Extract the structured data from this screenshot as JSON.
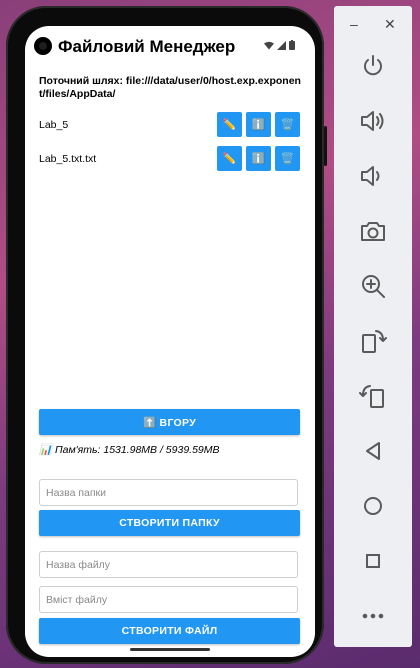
{
  "app": {
    "title": "Файловий Менеджер"
  },
  "path": {
    "text": "Поточний шлях: file:///data/user/0/host.exp.exponent/files/AppData/"
  },
  "files": [
    {
      "name": "Lab_5"
    },
    {
      "name": "Lab_5.txt.txt"
    }
  ],
  "actions": {
    "rename_icon": "✏️",
    "info_icon": "ℹ️",
    "delete_icon": "🗑️"
  },
  "buttons": {
    "up": "⬆️ ВГОРУ",
    "create_folder": "СТВОРИТИ ПАПКУ",
    "create_file": "СТВОРИТИ ФАЙЛ"
  },
  "memory": {
    "text": "📊 Пам'ять: 1531.98MB / 5939.59MB"
  },
  "inputs": {
    "folder_name_placeholder": "Назва папки",
    "file_name_placeholder": "Назва файлу",
    "file_content_placeholder": "Вміст файлу"
  },
  "emulator_panel": {
    "minimize": "–",
    "close": "✕",
    "tools": [
      "power-icon",
      "volume-up-icon",
      "volume-down-icon",
      "camera-icon",
      "zoom-in-icon",
      "rotate-left-icon",
      "rotate-right-icon",
      "back-icon",
      "home-icon",
      "overview-icon",
      "more-icon"
    ]
  },
  "colors": {
    "accent": "#2196f3",
    "panel": "#eeeff3",
    "icon": "#5a5a5a"
  }
}
